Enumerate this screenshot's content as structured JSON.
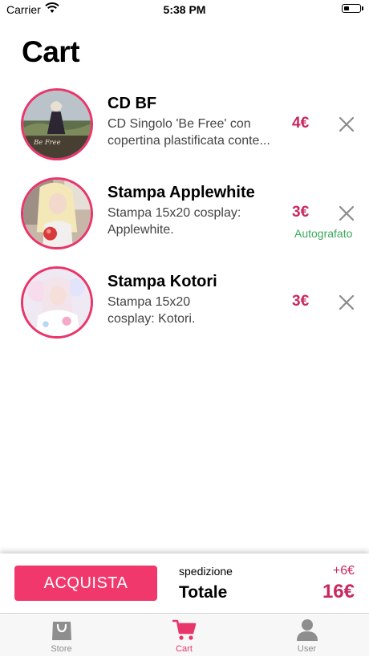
{
  "status_bar": {
    "carrier": "Carrier",
    "time": "5:38 PM"
  },
  "page": {
    "title": "Cart"
  },
  "cart": {
    "items": [
      {
        "name": "CD BF",
        "desc_line1": "CD Singolo 'Be Free' con",
        "desc_line2": "copertina plastificata conte...",
        "price": "4€",
        "note": ""
      },
      {
        "name": "Stampa Applewhite",
        "desc_line1": "Stampa 15x20 cosplay:",
        "desc_line2": "Applewhite.",
        "price": "3€",
        "note": "Autografato"
      },
      {
        "name": "Stampa Kotori",
        "desc_line1": "Stampa 15x20",
        "desc_line2": "cosplay: Kotori.",
        "price": "3€",
        "note": ""
      }
    ]
  },
  "checkout": {
    "buy_label": "ACQUISTA",
    "shipping_label": "spedizione",
    "shipping_value": "+6€",
    "total_label": "Totale",
    "total_value": "16€"
  },
  "tabs": [
    {
      "label": "Store",
      "icon": "bag-icon",
      "active": false
    },
    {
      "label": "Cart",
      "icon": "cart-icon",
      "active": true
    },
    {
      "label": "User",
      "icon": "user-icon",
      "active": false
    }
  ],
  "colors": {
    "accent": "#e8366a",
    "price": "#c8285b",
    "note": "#3aa85a",
    "inactive_tab": "#8e8e8e"
  }
}
